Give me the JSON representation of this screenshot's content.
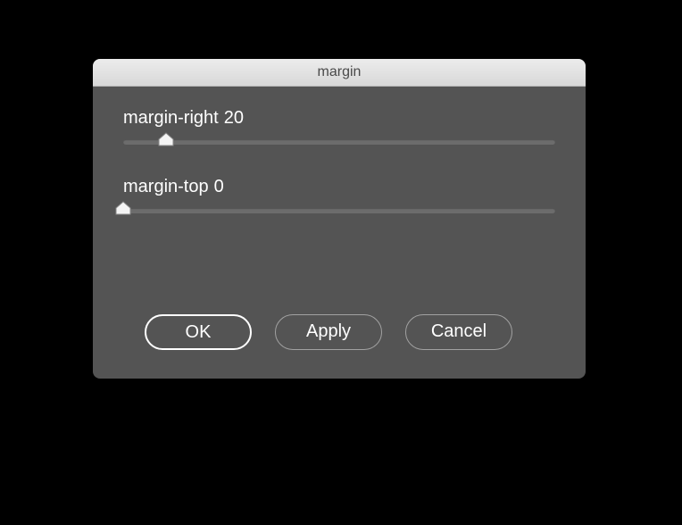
{
  "dialog": {
    "title": "margin",
    "sliders": [
      {
        "label": "margin-right",
        "value": 20,
        "min": 0,
        "max": 200
      },
      {
        "label": "margin-top",
        "value": 0,
        "min": 0,
        "max": 200
      }
    ],
    "buttons": {
      "ok": "OK",
      "apply": "Apply",
      "cancel": "Cancel"
    }
  }
}
